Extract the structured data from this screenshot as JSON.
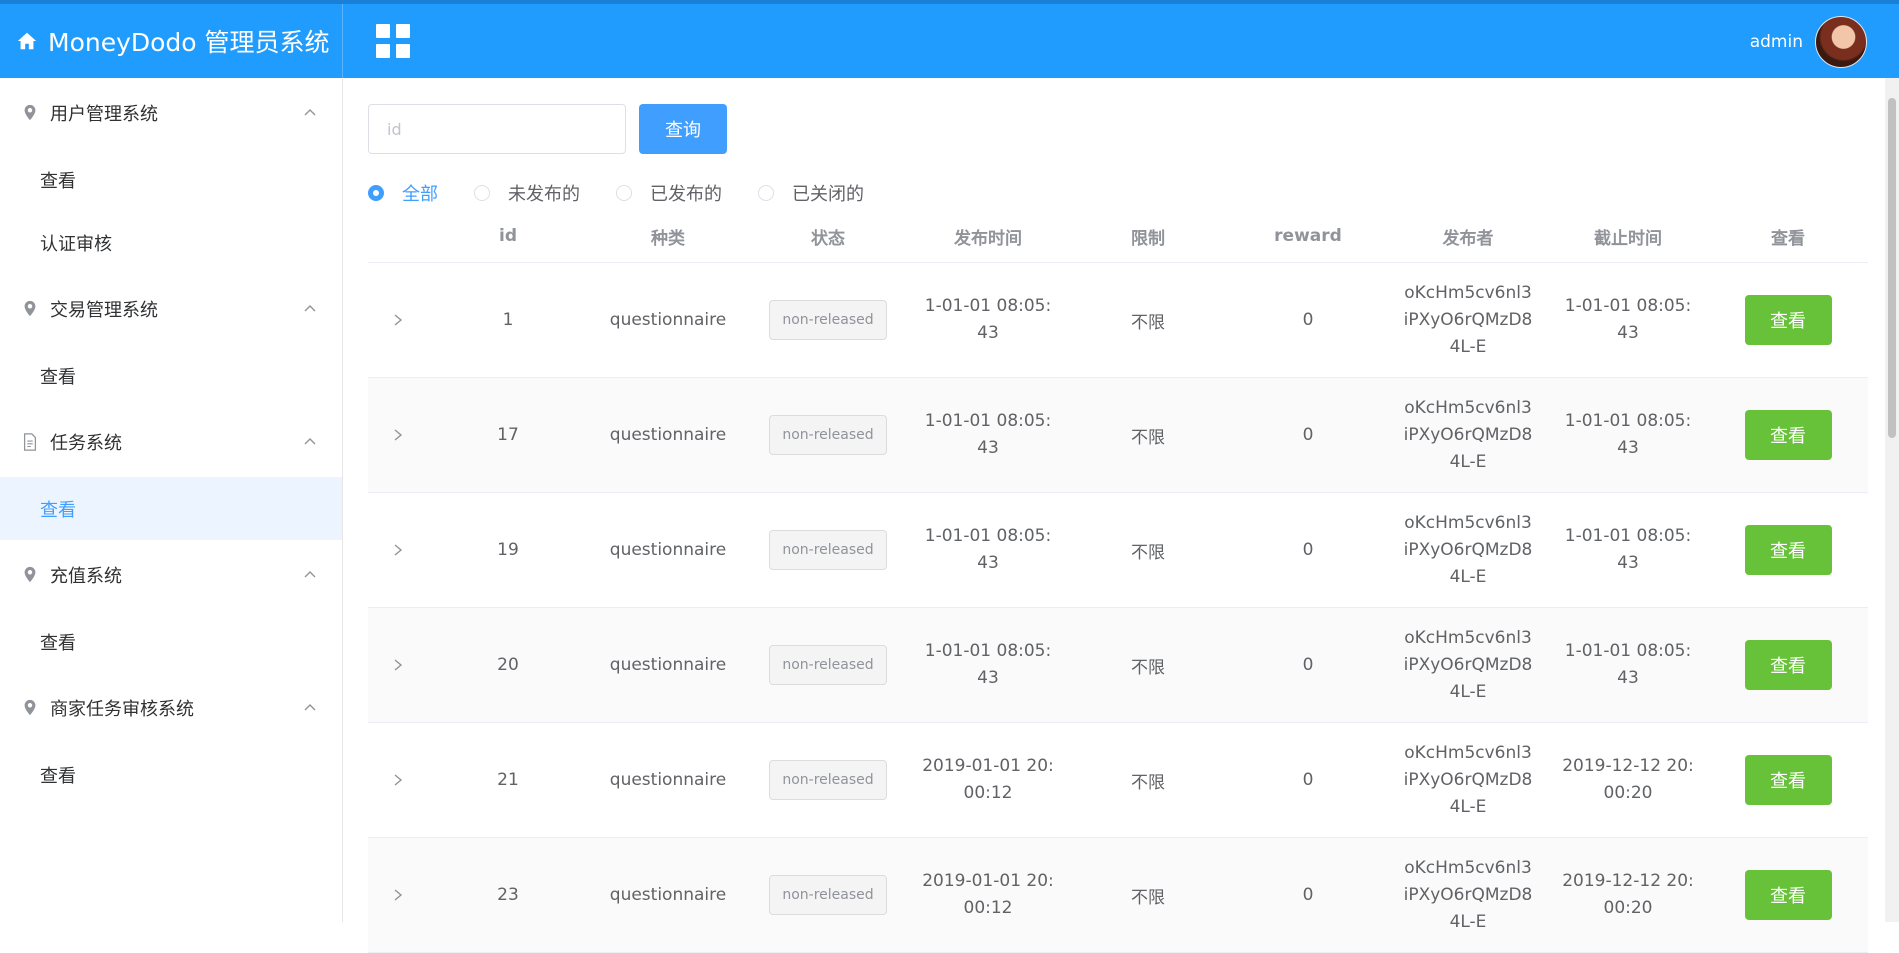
{
  "header": {
    "app_title": "MoneyDodo 管理员系统",
    "user_name": "admin",
    "icons": {
      "home": "home-icon",
      "menu": "grid-menu-icon",
      "avatar": "user-avatar"
    },
    "colors": {
      "header_bg": "#209cff",
      "primary": "#409eff",
      "success": "#67c23a"
    }
  },
  "sidebar": {
    "groups": [
      {
        "title": "用户管理系统",
        "icon": "location-pin-icon",
        "items": [
          "查看",
          "认证审核"
        ]
      },
      {
        "title": "交易管理系统",
        "icon": "location-pin-icon",
        "items": [
          "查看"
        ]
      },
      {
        "title": "任务系统",
        "icon": "document-icon",
        "items": [
          "查看"
        ]
      },
      {
        "title": "充值系统",
        "icon": "location-pin-icon",
        "items": [
          "查看"
        ]
      },
      {
        "title": "商家任务审核系统",
        "icon": "location-pin-icon",
        "items": [
          "查看"
        ]
      }
    ]
  },
  "search": {
    "placeholder": "id",
    "value": "",
    "button_label": "查询"
  },
  "filters": {
    "options": [
      "全部",
      "未发布的",
      "已发布的",
      "已关闭的"
    ],
    "selected": "全部"
  },
  "table": {
    "headers": [
      "id",
      "种类",
      "状态",
      "发布时间",
      "限制",
      "reward",
      "发布者",
      "截止时间",
      "查看"
    ],
    "rows": [
      {
        "id": "1",
        "type": "questionnaire",
        "status": "non-released",
        "publish_time": "1-01-01 08:05:43",
        "limit": "不限",
        "reward": "0",
        "publisher": "oKcHm5cv6nl3iPXyO6rQMzD84L-E",
        "deadline": "1-01-01 08:05:43",
        "action": "查看"
      },
      {
        "id": "17",
        "type": "questionnaire",
        "status": "non-released",
        "publish_time": "1-01-01 08:05:43",
        "limit": "不限",
        "reward": "0",
        "publisher": "oKcHm5cv6nl3iPXyO6rQMzD84L-E",
        "deadline": "1-01-01 08:05:43",
        "action": "查看"
      },
      {
        "id": "19",
        "type": "questionnaire",
        "status": "non-released",
        "publish_time": "1-01-01 08:05:43",
        "limit": "不限",
        "reward": "0",
        "publisher": "oKcHm5cv6nl3iPXyO6rQMzD84L-E",
        "deadline": "1-01-01 08:05:43",
        "action": "查看"
      },
      {
        "id": "20",
        "type": "questionnaire",
        "status": "non-released",
        "publish_time": "1-01-01 08:05:43",
        "limit": "不限",
        "reward": "0",
        "publisher": "oKcHm5cv6nl3iPXyO6rQMzD84L-E",
        "deadline": "1-01-01 08:05:43",
        "action": "查看"
      },
      {
        "id": "21",
        "type": "questionnaire",
        "status": "non-released",
        "publish_time": "2019-01-01 20:00:12",
        "limit": "不限",
        "reward": "0",
        "publisher": "oKcHm5cv6nl3iPXyO6rQMzD84L-E",
        "deadline": "2019-12-12 20:00:20",
        "action": "查看"
      },
      {
        "id": "23",
        "type": "questionnaire",
        "status": "non-released",
        "publish_time": "2019-01-01 20:00:12",
        "limit": "不限",
        "reward": "0",
        "publisher": "oKcHm5cv6nl3iPXyO6rQMzD84L-E",
        "deadline": "2019-12-12 20:00:20",
        "action": "查看"
      }
    ]
  }
}
